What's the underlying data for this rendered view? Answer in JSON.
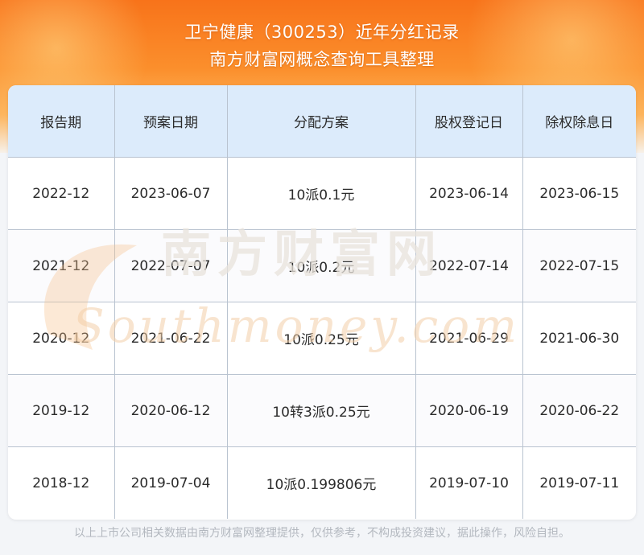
{
  "header": {
    "title_line1": "卫宁健康（300253）近年分红记录",
    "title_line2": "南方财富网概念查询工具整理"
  },
  "table": {
    "columns": [
      "报告期",
      "预案日期",
      "分配方案",
      "股权登记日",
      "除权除息日"
    ],
    "rows": [
      [
        "2022-12",
        "2023-06-07",
        "10派0.1元",
        "2023-06-14",
        "2023-06-15"
      ],
      [
        "2021-12",
        "2022-07-07",
        "10派0.2元",
        "2022-07-14",
        "2022-07-15"
      ],
      [
        "2020-12",
        "2021-06-22",
        "10派0.25元",
        "2021-06-29",
        "2021-06-30"
      ],
      [
        "2019-12",
        "2020-06-12",
        "10转3派0.25元",
        "2020-06-19",
        "2020-06-22"
      ],
      [
        "2018-12",
        "2019-07-04",
        "10派0.199806元",
        "2019-07-10",
        "2019-07-11"
      ]
    ]
  },
  "watermark": {
    "cn": "南方财富网",
    "en": "Southmoney.com"
  },
  "footer": {
    "disclaimer": "以上上市公司相关数据由南方财富网整理提供，仅供参考，不构成投资建议，据此操作，风险自担。"
  },
  "colors": {
    "header_orange": "#f8731a",
    "table_header_bg": "#dcebfb",
    "watermark": "#f3cfa8"
  }
}
